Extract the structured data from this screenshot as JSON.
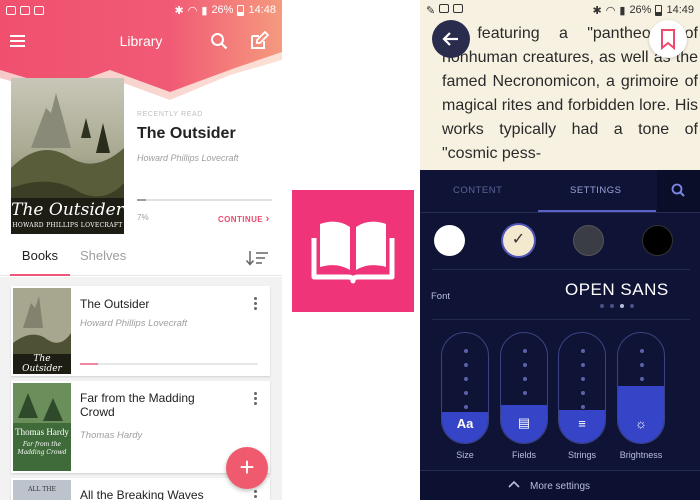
{
  "colors": {
    "accent": "#f0577a",
    "panel": "#0f1437",
    "panel_accent": "#3644c7"
  },
  "left_phone": {
    "status": {
      "battery": "26%",
      "time": "14:48"
    },
    "header": {
      "title": "Library",
      "menu_icon": "hamburger-menu-icon",
      "search_icon": "search-icon",
      "edit_icon": "edit-icon"
    },
    "recent": {
      "label": "RECENTLY READ",
      "title": "The Outsider",
      "author": "Howard Phillips Lovecraft",
      "progress": 7,
      "progress_text": "7%",
      "continue_label": "CONTINUE",
      "cover_title": "The Outsider",
      "cover_author": "HOWARD PHILLIPS LOVECRAFT"
    },
    "tabs": {
      "books": "Books",
      "shelves": "Shelves"
    },
    "books": [
      {
        "title": "The Outsider",
        "author": "Howard Phillips Lovecraft",
        "progress": 10,
        "cover_title": "The Outsider"
      },
      {
        "title": "Far from the Madding Crowd",
        "author": "Thomas Hardy",
        "cover_author": "Thomas Hardy",
        "cover_title": "Far from the Madding Crowd"
      },
      {
        "title": "All the Breaking Waves",
        "cover_title": "ALL THE"
      }
    ],
    "fab_label": "+"
  },
  "right_phone": {
    "status": {
      "battery": "26%",
      "time": "14:49"
    },
    "reading_text": "ks featuring a \"pantheon\" of nonhuman creatures, as well as the famed Necronomicon, a grimoire of magical rites and forbidden lore. His works typically had a tone of \"cosmic pess-",
    "panel": {
      "tabs": {
        "content": "CONTENT",
        "settings": "SETTINGS"
      },
      "font_label": "Font",
      "font_name": "OPEN SANS",
      "sliders": [
        {
          "label": "Size",
          "icon_text": "Aa",
          "level": 0.28
        },
        {
          "label": "Fields",
          "icon_text": "▤",
          "level": 0.35
        },
        {
          "label": "Strings",
          "icon_text": "≡",
          "level": 0.3
        },
        {
          "label": "Brightness",
          "icon_text": "☼",
          "level": 0.52
        }
      ],
      "more_label": "More settings"
    }
  }
}
